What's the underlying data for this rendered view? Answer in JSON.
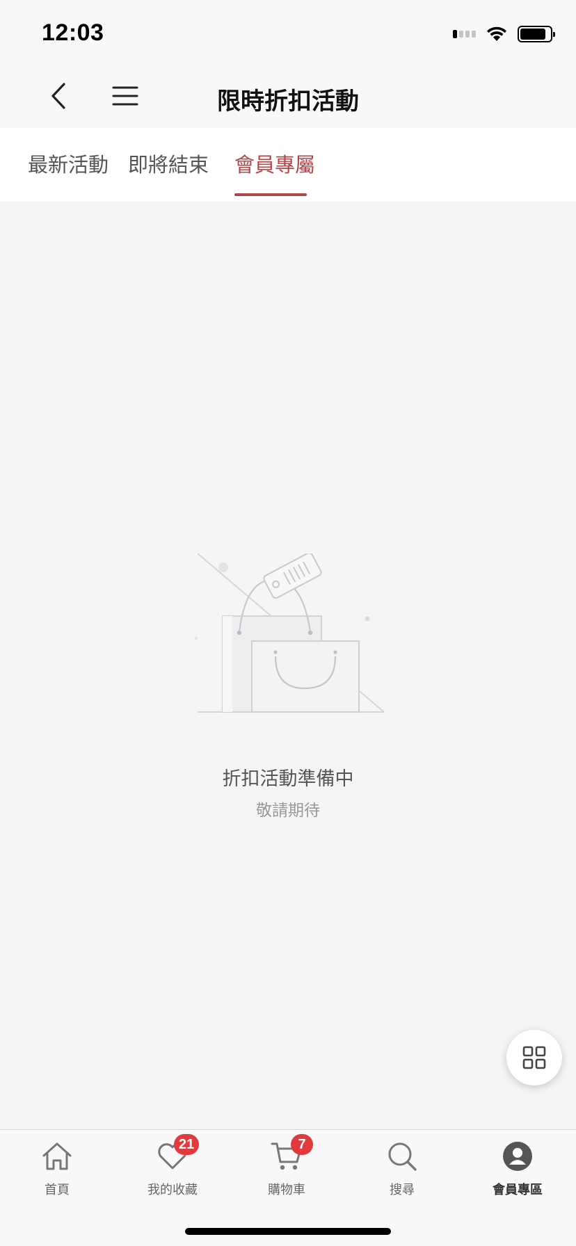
{
  "status_bar": {
    "time": "12:03"
  },
  "nav": {
    "title": "限時折扣活動",
    "back_icon": "chevron-left-icon",
    "menu_icon": "hamburger-menu-icon"
  },
  "tabs": [
    {
      "label": "最新活動",
      "active": false
    },
    {
      "label": "即將結束",
      "active": false
    },
    {
      "label": "會員專屬",
      "active": true
    }
  ],
  "empty_state": {
    "icon": "shopping-bag-tag-icon",
    "title": "折扣活動準備中",
    "subtitle": "敬請期待"
  },
  "fab": {
    "icon": "grid-icon"
  },
  "tabbar": [
    {
      "label": "首頁",
      "icon": "home-icon",
      "badge": null,
      "active": false
    },
    {
      "label": "我的收藏",
      "icon": "heart-icon",
      "badge": "21",
      "active": false
    },
    {
      "label": "購物車",
      "icon": "cart-icon",
      "badge": "7",
      "active": false
    },
    {
      "label": "搜尋",
      "icon": "search-icon",
      "badge": null,
      "active": false
    },
    {
      "label": "會員專區",
      "icon": "user-icon",
      "badge": null,
      "active": true
    }
  ],
  "colors": {
    "accent": "#b2474a",
    "badge": "#e13a3c",
    "background": "#f5f5f5"
  }
}
